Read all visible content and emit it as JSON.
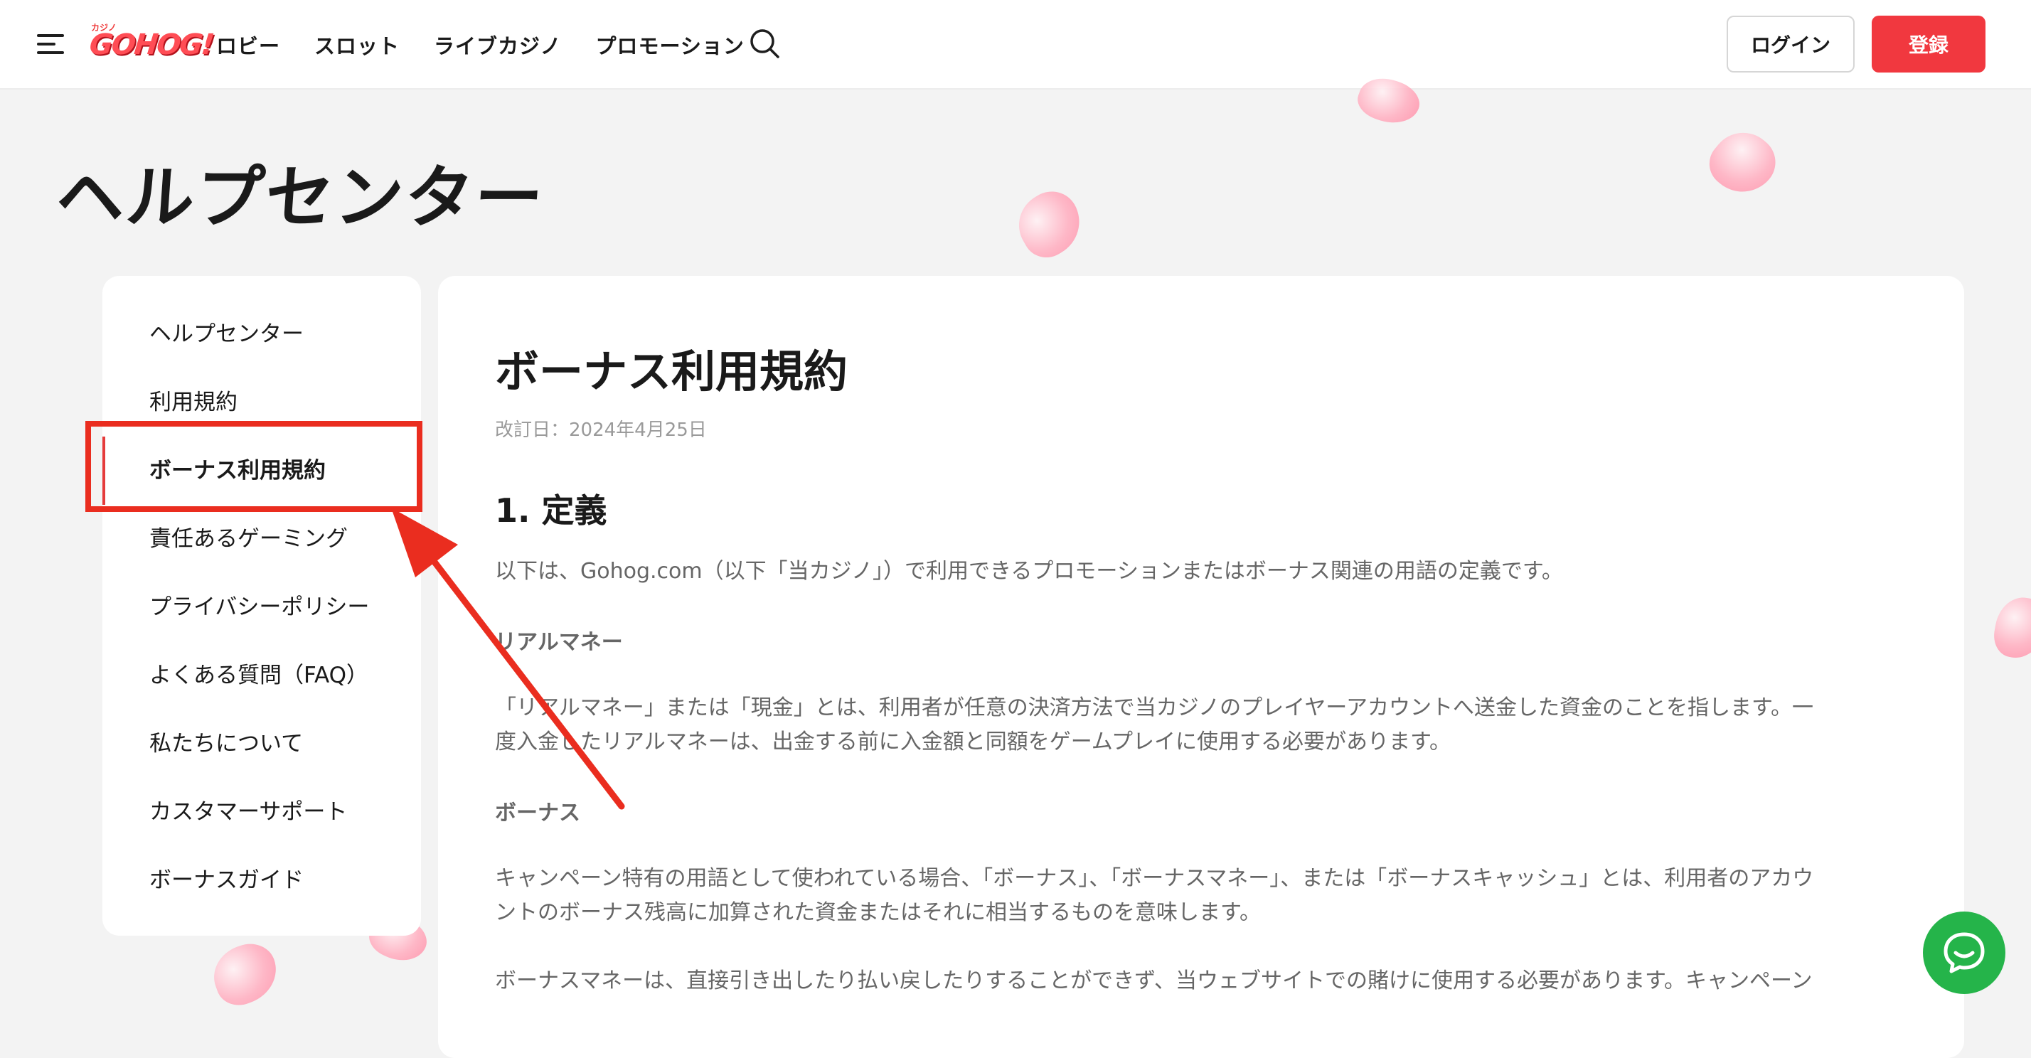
{
  "header": {
    "logo_small": "カジノ",
    "logo_text": "GOHOG!",
    "nav": [
      "ロビー",
      "スロット",
      "ライブカジノ",
      "プロモーション"
    ],
    "login_label": "ログイン",
    "register_label": "登録"
  },
  "page": {
    "title": "ヘルプセンター"
  },
  "sidebar": {
    "items": [
      {
        "label": "ヘルプセンター"
      },
      {
        "label": "利用規約"
      },
      {
        "label": "ボーナス利用規約"
      },
      {
        "label": "責任あるゲーミング"
      },
      {
        "label": "プライバシーポリシー"
      },
      {
        "label": "よくある質問（FAQ）"
      },
      {
        "label": "私たちについて"
      },
      {
        "label": "カスタマーサポート"
      },
      {
        "label": "ボーナスガイド"
      }
    ],
    "active_index": 2
  },
  "content": {
    "title": "ボーナス利用規約",
    "revised": "改訂日：2024年4月25日",
    "section_heading": "1. 定義",
    "intro": "以下は、Gohog.com（以下「当カジノ」）で利用できるプロモーションまたはボーナス関連の用語の定義です。",
    "term1": "リアルマネー",
    "term1_line1": "「リアルマネー」または「現金」とは、利用者が任意の決済方法で当カジノのプレイヤーアカウントへ送金した資金のことを指します。一",
    "term1_line2": "度入金したリアルマネーは、出金する前に入金額と同額をゲームプレイに使用する必要があります。",
    "term2": "ボーナス",
    "term2_line1": "キャンペーン特有の用語として使われている場合、「ボーナス」、「ボーナスマネー」、または「ボーナスキャッシュ」とは、利用者のアカウ",
    "term2_line2": "ントのボーナス残高に加算された資金またはそれに相当するものを意味します。",
    "para3_line1": "ボーナスマネーは、直接引き出したり払い戻したりすることができず、当ウェブサイトでの賭けに使用する必要があります。キャンペーン"
  },
  "colors": {
    "accent": "#f1383f",
    "highlight": "#ea2d1f",
    "chat": "#25b44a"
  }
}
